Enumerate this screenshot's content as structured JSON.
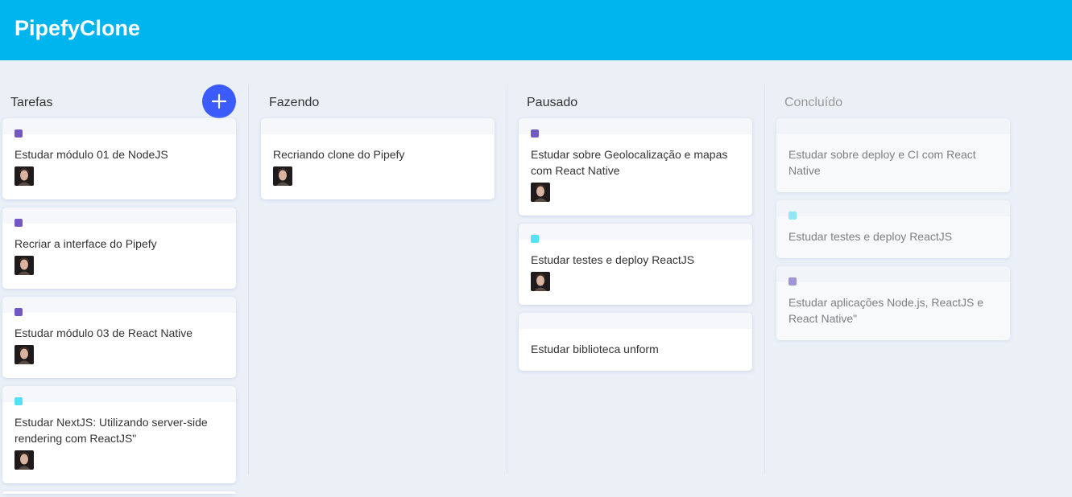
{
  "app": {
    "title": "PipefyClone"
  },
  "colors": {
    "header": "#00b5ee",
    "background": "#ebf0f7",
    "add_button": "#3b5bfd",
    "label_purple": "#7159c1",
    "label_cyan": "#54e1f7"
  },
  "icons": {
    "add": "plus-icon",
    "avatar": "user-avatar-photo"
  },
  "lists": [
    {
      "title": "Tarefas",
      "creatable": true,
      "cards": [
        {
          "content": "Estudar módulo 01 de NodeJS",
          "label": "#7159c1",
          "has_avatar": true
        },
        {
          "content": "Recriar a interface do Pipefy",
          "label": "#7159c1",
          "has_avatar": true
        },
        {
          "content": "Estudar módulo 03 de React Native",
          "label": "#7159c1",
          "has_avatar": true
        },
        {
          "content": "Estudar NextJS: Utilizando server-side rendering com ReactJS\"",
          "label": "#54e1f7",
          "has_avatar": true
        }
      ]
    },
    {
      "title": "Fazendo",
      "cards": [
        {
          "content": "Recriando clone do Pipefy",
          "label": null,
          "has_avatar": true
        }
      ]
    },
    {
      "title": "Pausado",
      "cards": [
        {
          "content": "Estudar sobre Geolocalização e mapas com React Native",
          "label": "#7159c1",
          "has_avatar": true
        },
        {
          "content": "Estudar testes e deploy ReactJS",
          "label": "#54e1f7",
          "has_avatar": true
        },
        {
          "content": "Estudar biblioteca unform",
          "label": null,
          "has_avatar": false
        }
      ]
    },
    {
      "title": "Concluído",
      "done": true,
      "cards": [
        {
          "content": "Estudar sobre deploy e CI com React Native",
          "label": null,
          "has_avatar": false
        },
        {
          "content": "Estudar testes e deploy ReactJS",
          "label": "#54e1f7",
          "has_avatar": false
        },
        {
          "content": "Estudar aplicações Node.js, ReactJS e React Native\"",
          "label": "#7159c1",
          "has_avatar": false
        }
      ]
    }
  ]
}
